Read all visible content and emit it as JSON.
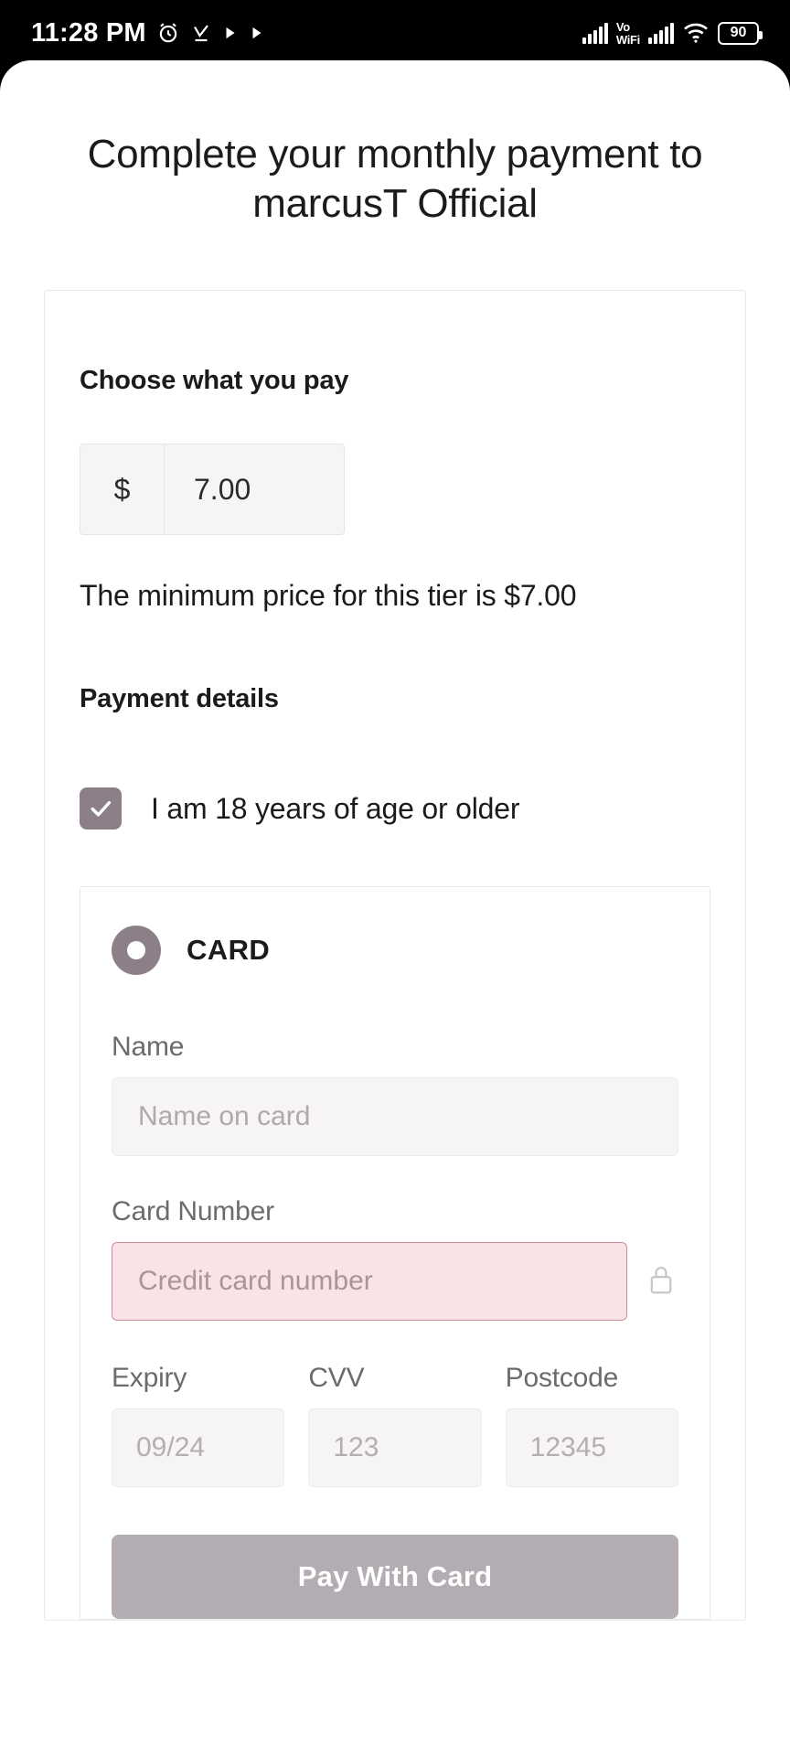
{
  "status_bar": {
    "time": "11:28 PM",
    "battery_level": "90",
    "vowifi_top": "Vo",
    "vowifi_bottom": "WiFi",
    "icons": [
      "alarm-clock-icon",
      "download-complete-icon",
      "play-triangle-icon",
      "play-triangle-icon",
      "signal-bars-icon",
      "vowifi-icon",
      "signal-bars-icon",
      "wifi-icon",
      "battery-icon"
    ]
  },
  "page": {
    "title": "Complete your monthly payment to marcusT Official"
  },
  "pay_section": {
    "heading": "Choose what you pay",
    "currency_symbol": "$",
    "amount_value": "7.00",
    "minimum_note": "The minimum price for this tier is $7.00"
  },
  "payment_details": {
    "heading": "Payment details",
    "age_checkbox_label": "I am 18 years of age or older",
    "age_checkbox_checked": true,
    "method": {
      "label": "CARD",
      "selected": true
    },
    "fields": {
      "name_label": "Name",
      "name_placeholder": "Name on card",
      "card_number_label": "Card Number",
      "card_number_placeholder": "Credit card number",
      "card_number_error": true,
      "expiry_label": "Expiry",
      "expiry_placeholder": "09/24",
      "cvv_label": "CVV",
      "cvv_placeholder": "123",
      "postcode_label": "Postcode",
      "postcode_placeholder": "12345"
    },
    "submit_label": "Pay With Card"
  },
  "colors": {
    "accent_mauve": "#8d7f88",
    "button_gray": "#b3acb2",
    "error_bg": "#fae3e6",
    "error_border": "#cf8b96",
    "input_bg": "#f6f4f4"
  }
}
